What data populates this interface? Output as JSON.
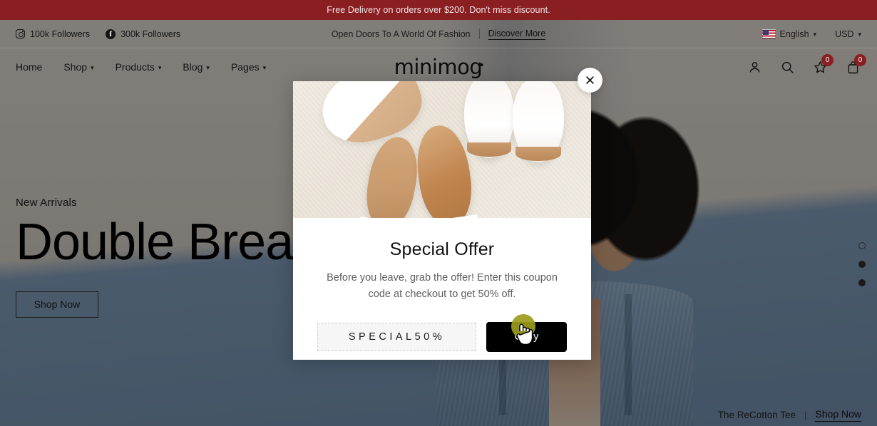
{
  "announcement": {
    "text": "Free Delivery on orders over $200. Don't miss discount.",
    "bg": "#8a1f22"
  },
  "topbar": {
    "social": [
      {
        "icon": "instagram-icon",
        "label": "100k Followers"
      },
      {
        "icon": "facebook-icon",
        "label": "300k Followers"
      }
    ],
    "tagline": "Open Doors To A World Of Fashion",
    "discover_label": "Discover More",
    "language": "English",
    "currency": "USD",
    "flag": "us-flag-icon"
  },
  "header": {
    "nav": [
      {
        "label": "Home",
        "has_caret": false
      },
      {
        "label": "Shop",
        "has_caret": true
      },
      {
        "label": "Products",
        "has_caret": true
      },
      {
        "label": "Blog",
        "has_caret": true
      },
      {
        "label": "Pages",
        "has_caret": true
      }
    ],
    "logo": "minimog",
    "icons": [
      {
        "name": "account-icon",
        "badge": null
      },
      {
        "name": "search-icon",
        "badge": null
      },
      {
        "name": "wishlist-star-icon",
        "badge": "0"
      },
      {
        "name": "cart-bag-icon",
        "badge": "0"
      }
    ],
    "badge_color": "#8a1f22"
  },
  "hero": {
    "eyebrow": "New Arrivals",
    "title": "Double Breasted",
    "cta": "Shop Now",
    "footer_product": "The ReCotton Tee",
    "footer_separator": "|",
    "footer_link": "Shop Now",
    "slider_dots": [
      {
        "active": true
      },
      {
        "active": false
      },
      {
        "active": false
      }
    ]
  },
  "modal": {
    "title": "Special Offer",
    "description": "Before you leave, grab the offer! Enter this coupon code at checkout to get 50% off.",
    "coupon_code": "SPECIAL50%",
    "copy_label": "Copy",
    "close_icon": "close-icon",
    "image_alt": "shoes-on-carpet-photo"
  },
  "cursor": {
    "icon": "hand-pointer-cursor",
    "click_highlight_color": "#9b9b1b"
  }
}
